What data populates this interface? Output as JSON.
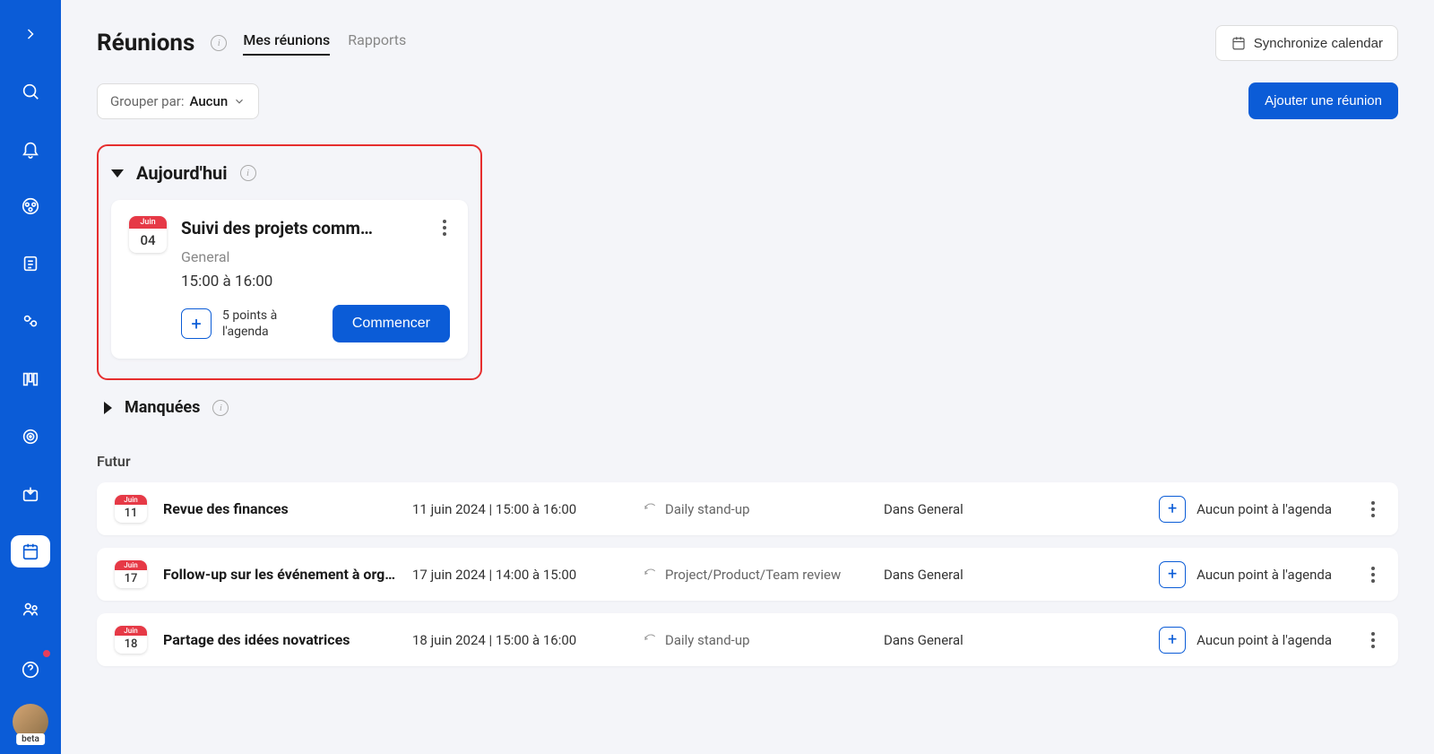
{
  "page": {
    "title": "Réunions",
    "tabs": [
      "Mes réunions",
      "Rapports"
    ],
    "syncButton": "Synchronize calendar",
    "addButton": "Ajouter une réunion",
    "groupBy": {
      "label": "Grouper par:",
      "value": "Aucun"
    }
  },
  "today": {
    "sectionTitle": "Aujourd'hui",
    "card": {
      "month": "Juin",
      "day": "04",
      "title": "Suivi des projets comm…",
      "space": "General",
      "time": "15:00 à 16:00",
      "agenda": "5 points à l'agenda",
      "start": "Commencer"
    }
  },
  "missed": {
    "sectionTitle": "Manquées"
  },
  "future": {
    "sectionTitle": "Futur",
    "rows": [
      {
        "month": "Juin",
        "day": "11",
        "title": "Revue des finances",
        "datetime": "11 juin 2024 | 15:00 à 16:00",
        "recur": "Daily stand-up",
        "space": "Dans General",
        "agenda": "Aucun point à l'agenda"
      },
      {
        "month": "Juin",
        "day": "17",
        "title": "Follow-up sur les événement à organ…",
        "datetime": "17 juin 2024 | 14:00 à 15:00",
        "recur": "Project/Product/Team review",
        "space": "Dans General",
        "agenda": "Aucun point à l'agenda"
      },
      {
        "month": "Juin",
        "day": "18",
        "title": "Partage des idées novatrices",
        "datetime": "18 juin 2024 | 15:00 à 16:00",
        "recur": "Daily stand-up",
        "space": "Dans General",
        "agenda": "Aucun point à l'agenda"
      }
    ]
  },
  "betaLabel": "beta"
}
